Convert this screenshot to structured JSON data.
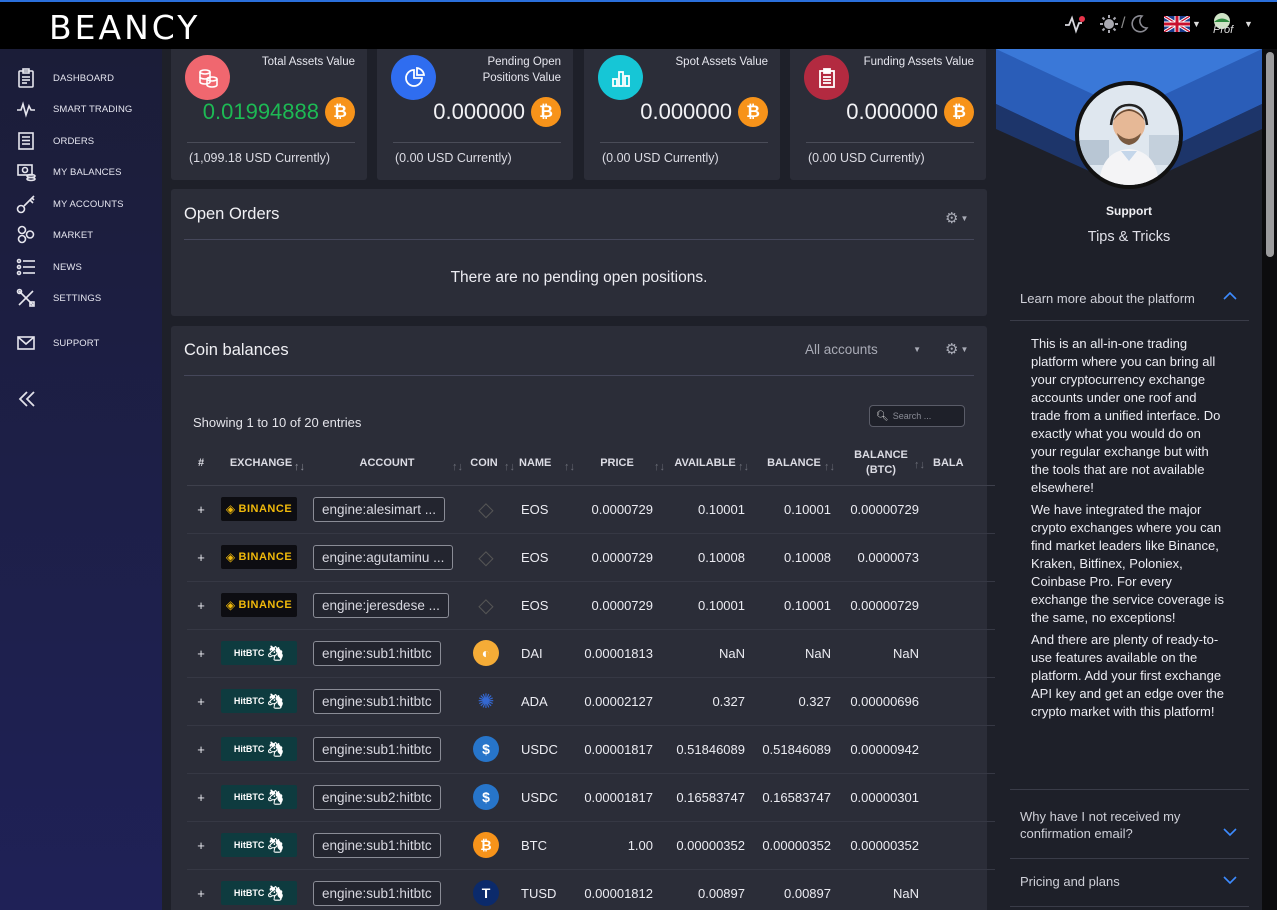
{
  "brand": "BEANCY",
  "topbar": {
    "avatar_text": "Prof"
  },
  "sidebar": {
    "items": [
      {
        "label": "DASHBOARD",
        "icon": "clipboard-icon"
      },
      {
        "label": "SMART TRADING",
        "icon": "pulse-icon"
      },
      {
        "label": "ORDERS",
        "icon": "list-document-icon"
      },
      {
        "label": "MY BALANCES",
        "icon": "coins-icon"
      },
      {
        "label": "MY ACCOUNTS",
        "icon": "key-icon"
      },
      {
        "label": "MARKET",
        "icon": "market-icon"
      },
      {
        "label": "NEWS",
        "icon": "bullet-list-icon"
      },
      {
        "label": "SETTINGS",
        "icon": "tools-icon"
      },
      {
        "label": "SUPPORT",
        "icon": "envelope-icon"
      }
    ]
  },
  "stats": [
    {
      "label": "Total Assets Value",
      "value": "0.01994888",
      "usd": "(1,099.18 USD Currently)",
      "color": "#f0676f",
      "icon": "coins-stack-icon"
    },
    {
      "label": "Pending Open Positions Value",
      "value": "0.000000",
      "usd": "(0.00 USD Currently)",
      "color": "#2f6df0",
      "icon": "pie-chart-icon"
    },
    {
      "label": "Spot Assets Value",
      "value": "0.000000",
      "usd": "(0.00 USD Currently)",
      "color": "#16c6d6",
      "icon": "bar-chart-icon"
    },
    {
      "label": "Funding Assets Value",
      "value": "0.000000",
      "usd": "(0.00 USD Currently)",
      "color": "#b32a40",
      "icon": "clipboard-list-icon"
    }
  ],
  "open_orders": {
    "title": "Open Orders",
    "empty_text": "There are no pending open positions."
  },
  "balances": {
    "title": "Coin balances",
    "filter": "All accounts",
    "showing": "Showing 1 to 10 of 20 entries",
    "search_placeholder": "Search ...",
    "columns": [
      "#",
      "EXCHANGE",
      "ACCOUNT",
      "COIN",
      "NAME",
      "PRICE",
      "AVAILABLE",
      "BALANCE",
      "BALANCE (BTC)",
      "BALA"
    ],
    "rows": [
      {
        "exchange": "BINANCE",
        "account": "engine:alesimart ...",
        "coin": "EOS",
        "price": "0.0000729",
        "available": "0.10001",
        "balance": "0.10001",
        "btc": "0.00000729"
      },
      {
        "exchange": "BINANCE",
        "account": "engine:agutaminu ...",
        "coin": "EOS",
        "price": "0.0000729",
        "available": "0.10008",
        "balance": "0.10008",
        "btc": "0.0000073"
      },
      {
        "exchange": "BINANCE",
        "account": "engine:jeresdese ...",
        "coin": "EOS",
        "price": "0.0000729",
        "available": "0.10001",
        "balance": "0.10001",
        "btc": "0.00000729"
      },
      {
        "exchange": "HitBTC",
        "account": "engine:sub1:hitbtc",
        "coin": "DAI",
        "price": "0.00001813",
        "available": "NaN",
        "balance": "NaN",
        "btc": "NaN"
      },
      {
        "exchange": "HitBTC",
        "account": "engine:sub1:hitbtc",
        "coin": "ADA",
        "price": "0.00002127",
        "available": "0.327",
        "balance": "0.327",
        "btc": "0.00000696"
      },
      {
        "exchange": "HitBTC",
        "account": "engine:sub1:hitbtc",
        "coin": "USDC",
        "price": "0.00001817",
        "available": "0.51846089",
        "balance": "0.51846089",
        "btc": "0.00000942"
      },
      {
        "exchange": "HitBTC",
        "account": "engine:sub2:hitbtc",
        "coin": "USDC",
        "price": "0.00001817",
        "available": "0.16583747",
        "balance": "0.16583747",
        "btc": "0.00000301"
      },
      {
        "exchange": "HitBTC",
        "account": "engine:sub1:hitbtc",
        "coin": "BTC",
        "price": "1.00",
        "available": "0.00000352",
        "balance": "0.00000352",
        "btc": "0.00000352"
      },
      {
        "exchange": "HitBTC",
        "account": "engine:sub1:hitbtc",
        "coin": "TUSD",
        "price": "0.00001812",
        "available": "0.00897",
        "balance": "0.00897",
        "btc": "NaN"
      }
    ]
  },
  "support": {
    "title": "Support",
    "subtitle": "Tips & Tricks",
    "faq_open_q": "Learn more about the platform",
    "faq_open_p1": "This is an all-in-one trading platform where you can bring all your cryptocurrency exchange accounts under one roof and trade from a unified interface. Do exactly what you would do on your regular exchange but with the tools that are not available elsewhere!",
    "faq_open_p2": "We have integrated the major crypto exchanges where you can find market leaders like Binance, Kraken, Bitfinex, Poloniex, Coinbase Pro. For every exchange the service coverage is the same, no exceptions!",
    "faq_open_p3": "And there are plenty of ready-to-use features available on the platform. Add your first exchange API key and get an edge over the crypto market with this platform!",
    "faq_q2": "Why have I not received my confirmation email?",
    "faq_q3": "Pricing and plans"
  }
}
